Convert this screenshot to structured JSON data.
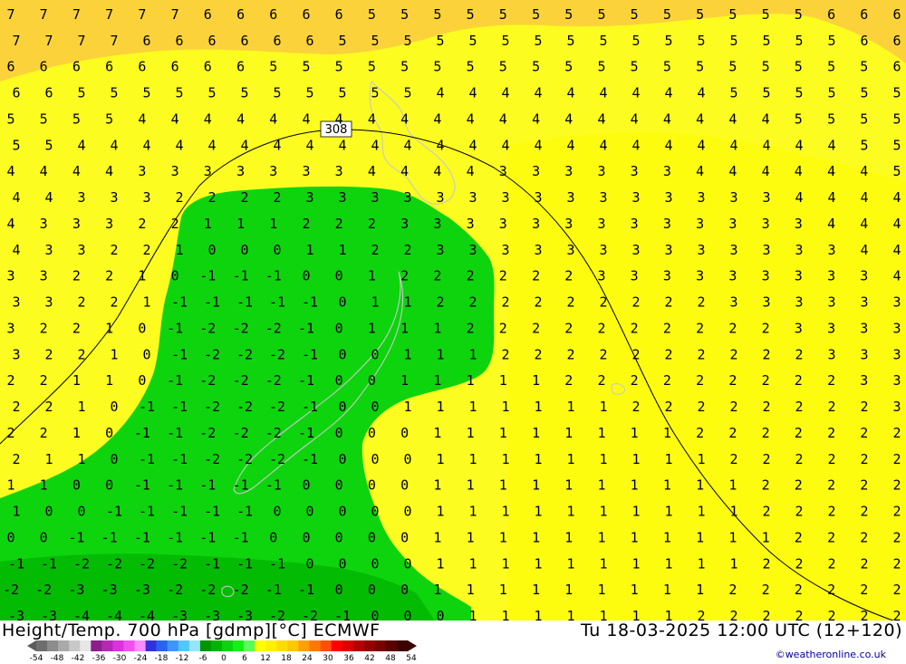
{
  "title": "Height/Temp. 700 hPa [gdmp][°C] ECMWF",
  "datetime": "Tu 18-03-2025 12:00 UTC (12+120)",
  "credit": "©weatheronline.co.uk",
  "height_contour_label": "308",
  "colors": {
    "orange_band": "#fcd23a",
    "yellow_band": "#fcfc20",
    "yellow_light": "#fffc00",
    "green_band": "#0ed40e",
    "green_dark": "#00b000",
    "coast": "#c8c8c8",
    "contour": "#000000"
  },
  "color_scale": {
    "labels": [
      "-54",
      "-48",
      "-42",
      "-36",
      "-30",
      "-24",
      "-18",
      "-12",
      "-6",
      "0",
      "6",
      "12",
      "18",
      "24",
      "30",
      "36",
      "42",
      "48",
      "54"
    ],
    "colors": [
      "#6e6e6e",
      "#8c8c8c",
      "#aaaaaa",
      "#c8c8c8",
      "#e6e6e6",
      "#8c1e8c",
      "#b428b4",
      "#dc32dc",
      "#f050f0",
      "#ff8cff",
      "#3232dc",
      "#2864f0",
      "#3c96ff",
      "#50c8ff",
      "#96e6ff",
      "#009600",
      "#00b400",
      "#0ed20e",
      "#14f014",
      "#5aff5a",
      "#ffff00",
      "#fff000",
      "#ffdc00",
      "#ffc800",
      "#ffa000",
      "#ff7800",
      "#ff5000",
      "#ff0000",
      "#dc0000",
      "#b40000",
      "#960000",
      "#780000",
      "#5a0000",
      "#3c0000"
    ]
  },
  "temperature_grid": [
    "7 7 7 7 7 7 6 6 6 6 6 5 5 5 5 5 5 5 5 5 5 5 5 5 5 6 6 6",
    "7 7 7 7 6 6 6 6 6 6 5 5 5 5 5 5 5 5 5 5 5 5 5 5 5 5 6 6",
    "6 6 6 6 6 6 6 6 5 5 5 5 5 5 5 5 5 5 5 5 5 5 5 5 5 5 5 6",
    "6 6 5 5 5 5 5 5 5 5 5 5 5 4 4 4 4 4 4 4 4 4 5 5 5 5 5 5",
    "5 5 5 5 4 4 4 4 4 4 4 4 4 4 4 4 4 4 4 4 4 4 4 4 5 5 5 5",
    "5 5 4 4 4 4 4 4 4 4 4 4 4 4 4 4 4 4 4 4 4 4 4 4 4 4 5 5",
    "4 4 4 4 3 3 3 3 3 3 3 4 4 4 4 3 3 3 3 3 3 4 4 4 4 4 4 5",
    "4 4 3 3 3 2 2 2 2 3 3 3 3 3 3 3 3 3 3 3 3 3 3 3 4 4 4 4",
    "4 3 3 3 2 2 1 1 1 2 2 2 3 3 3 3 3 3 3 3 3 3 3 3 3 4 4 4",
    "4 3 3 2 2 1 0 0 0 1 1 2 2 3 3 3 3 3 3 3 3 3 3 3 3 3 4 4",
    "3 3 2 2 1 0 -1 -1 -1 0 0 1 2 2 2 2 2 2 3 3 3 3 3 3 3 3 3 4",
    "3 3 2 2 1 -1 -1 -1 -1 -1 0 1 1 2 2 2 2 2 2 2 2 2 3 3 3 3 3 3",
    "3 2 2 1 0 -1 -2 -2 -2 -1 0 1 1 1 2 2 2 2 2 2 2 2 2 2 3 3 3 3",
    "3 2 2 1 0 -1 -2 -2 -2 -1 0 0 1 1 1 2 2 2 2 2 2 2 2 2 2 3 3 3",
    "2 2 1 1 0 -1 -2 -2 -2 -1 0 0 1 1 1 1 1 2 2 2 2 2 2 2 2 2 3 3",
    "2 2 1 0 -1 -1 -2 -2 -2 -1 0 0 1 1 1 1 1 1 1 2 2 2 2 2 2 2 2 3",
    "2 2 1 0 -1 -1 -2 -2 -2 -1 0 0 0 1 1 1 1 1 1 1 1 2 2 2 2 2 2 2",
    "2 1 1 0 -1 -1 -2 -2 -2 -1 0 0 0 1 1 1 1 1 1 1 1 1 2 2 2 2 2 2",
    "1 1 0 0 -1 -1 -1 -1 -1 0 0 0 0 1 1 1 1 1 1 1 1 1 1 2 2 2 2 2",
    "1 0 0 -1 -1 -1 -1 -1 0 0 0 0 0 1 1 1 1 1 1 1 1 1 1 2 2 2 2 2",
    "0 0 -1 -1 -1 -1 -1 -1 0 0 0 0 0 1 1 1 1 1 1 1 1 1 1 1 2 2 2 2",
    "-1 -1 -2 -2 -2 -2 -1 -1 -1 0 0 0 0 1 1 1 1 1 1 1 1 1 1 2 2 2 2 2",
    "-2 -2 -3 -3 -3 -2 -2 -2 -1 -1 0 0 0 1 1 1 1 1 1 1 1 1 2 2 2 2 2 2",
    "-3 -3 -4 -4 -4 -3 -3 -3 -2 -2 -1 0 0 0 1 1 1 1 1 1 1 2 2 2 2 2 2 2"
  ]
}
